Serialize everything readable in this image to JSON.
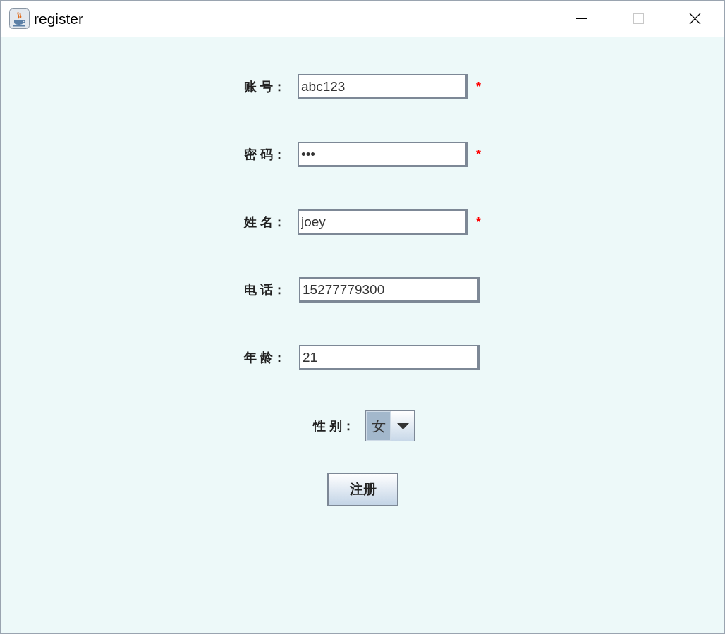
{
  "window": {
    "title": "register"
  },
  "fields": [
    {
      "label": "账 号：",
      "value": "abc123",
      "required": true,
      "star": "*"
    },
    {
      "label": "密 码：",
      "value": "•••",
      "required": true,
      "star": "*"
    },
    {
      "label": "姓 名：",
      "value": "joey",
      "required": true,
      "star": "*"
    },
    {
      "label": "电 话：",
      "value": "15277779300",
      "required": false
    },
    {
      "label": "年 龄：",
      "value": "21",
      "required": false
    }
  ],
  "gender": {
    "label": "性 别：",
    "value": "女"
  },
  "submit": {
    "label": "注册"
  }
}
